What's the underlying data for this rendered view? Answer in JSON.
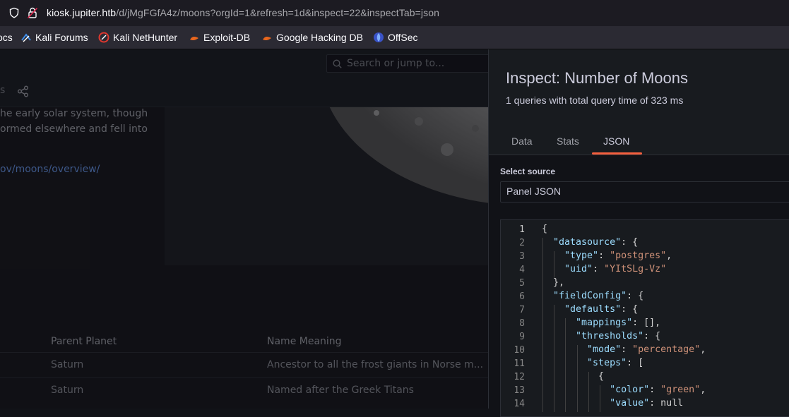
{
  "browser": {
    "url_host": "kiosk.jupiter.htb",
    "url_path": "/d/jMgFGfA4z/moons?orgId=1&refresh=1d&inspect=22&inspectTab=json",
    "bookmarks": [
      {
        "label": "ocs",
        "icon": "none"
      },
      {
        "label": "Kali Forums",
        "icon": "kali-forums-icon"
      },
      {
        "label": "Kali NetHunter",
        "icon": "kali-nethunter-icon"
      },
      {
        "label": "Exploit-DB",
        "icon": "exploit-db-icon"
      },
      {
        "label": "Google Hacking DB",
        "icon": "ghdb-icon"
      },
      {
        "label": "OffSec",
        "icon": "offsec-icon"
      }
    ]
  },
  "dashboard": {
    "search_placeholder": "Search or jump to...",
    "partial_s": "s",
    "panel_text_lines": [
      "he early solar system, though",
      "ormed elsewhere and fell into"
    ],
    "panel_link": "ov/moons/overview/",
    "table": {
      "headers": [
        "Parent Planet",
        "Name Meaning"
      ],
      "rows": [
        [
          "Saturn",
          "Ancestor to all the frost giants in Norse m..."
        ],
        [
          "Saturn",
          "Named after the Greek Titans"
        ]
      ]
    }
  },
  "inspect": {
    "title": "Inspect: Number of Moons",
    "subtitle": "1 queries with total query time of 323 ms",
    "tabs": [
      "Data",
      "Stats",
      "JSON"
    ],
    "active_tab": "JSON",
    "source_label": "Select source",
    "source_value": "Panel JSON",
    "code_lines": [
      "{",
      "  \"datasource\": {",
      "    \"type\": \"postgres\",",
      "    \"uid\": \"YItSLg-Vz\"",
      "  },",
      "  \"fieldConfig\": {",
      "    \"defaults\": {",
      "      \"mappings\": [],",
      "      \"thresholds\": {",
      "        \"mode\": \"percentage\",",
      "        \"steps\": [",
      "          {",
      "            \"color\": \"green\",",
      "            \"value\": null"
    ],
    "line_numbers": [
      "1",
      "2",
      "3",
      "4",
      "5",
      "6",
      "7",
      "8",
      "9",
      "10",
      "11",
      "12",
      "13",
      "14"
    ]
  },
  "colors": {
    "accent": "#f55f3e",
    "json_key": "#9cdcfe",
    "json_string": "#ce9178"
  }
}
